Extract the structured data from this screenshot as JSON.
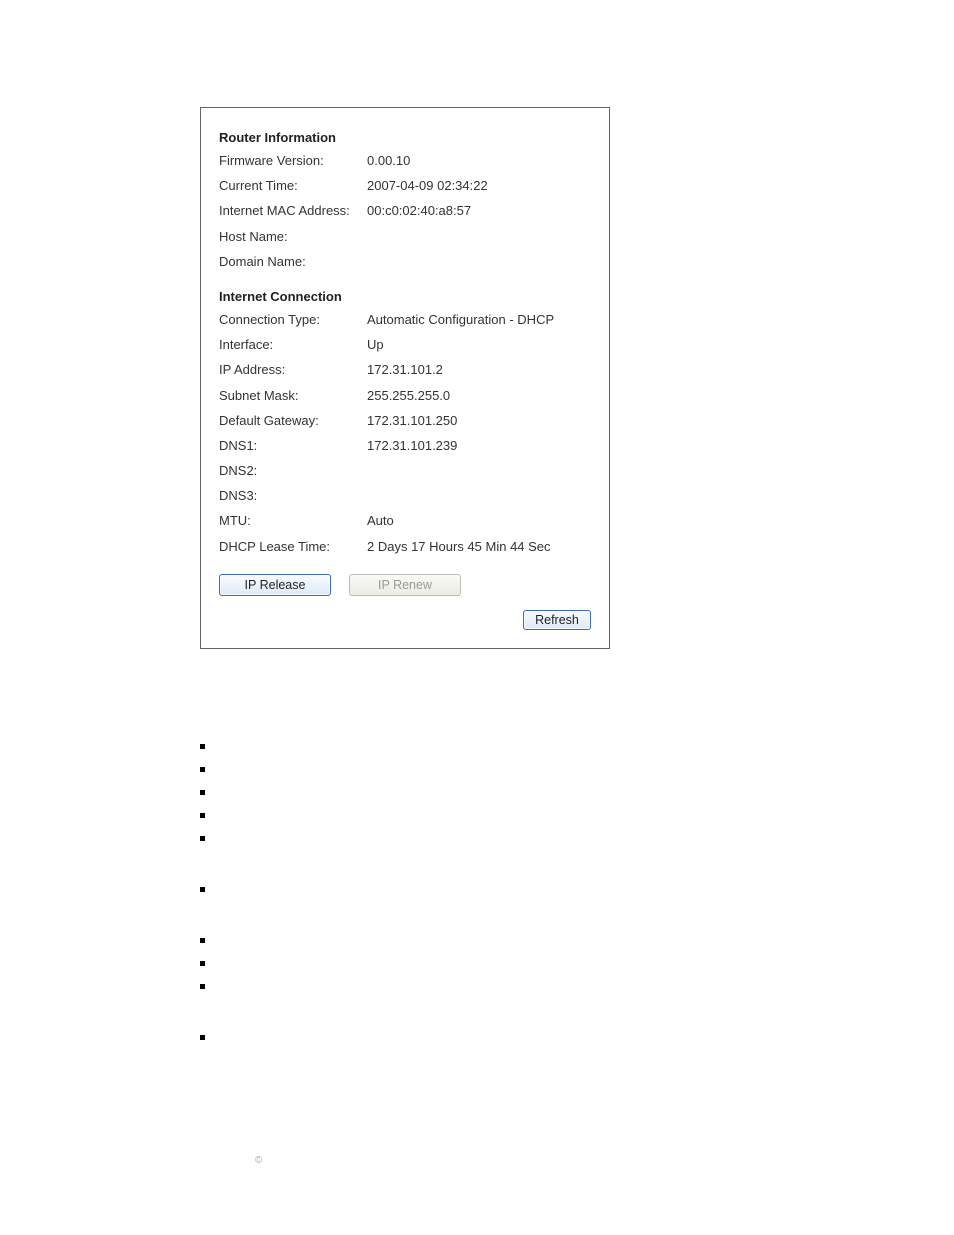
{
  "router_info": {
    "title": "Router Information",
    "firmware_version_label": "Firmware Version:",
    "firmware_version_value": "0.00.10",
    "current_time_label": "Current Time:",
    "current_time_value": "2007-04-09 02:34:22",
    "mac_label": "Internet MAC Address:",
    "mac_value": "00:c0:02:40:a8:57",
    "host_name_label": "Host Name:",
    "host_name_value": "",
    "domain_name_label": "Domain Name:",
    "domain_name_value": ""
  },
  "internet_connection": {
    "title": "Internet Connection",
    "connection_type_label": "Connection Type:",
    "connection_type_value": "Automatic Configuration - DHCP",
    "interface_label": "Interface:",
    "interface_value": "Up",
    "ip_address_label": "IP Address:",
    "ip_address_value": "172.31.101.2",
    "subnet_mask_label": "Subnet Mask:",
    "subnet_mask_value": "255.255.255.0",
    "default_gateway_label": "Default Gateway:",
    "default_gateway_value": "172.31.101.250",
    "dns1_label": "DNS1:",
    "dns1_value": "172.31.101.239",
    "dns2_label": "DNS2:",
    "dns2_value": "",
    "dns3_label": "DNS3:",
    "dns3_value": "",
    "mtu_label": "MTU:",
    "mtu_value": "Auto",
    "lease_label": "DHCP Lease Time:",
    "lease_value": "2 Days 17 Hours 45 Min 44 Sec"
  },
  "buttons": {
    "ip_release": "IP Release",
    "ip_renew": "IP Renew",
    "refresh": "Refresh"
  },
  "copyright": "©"
}
